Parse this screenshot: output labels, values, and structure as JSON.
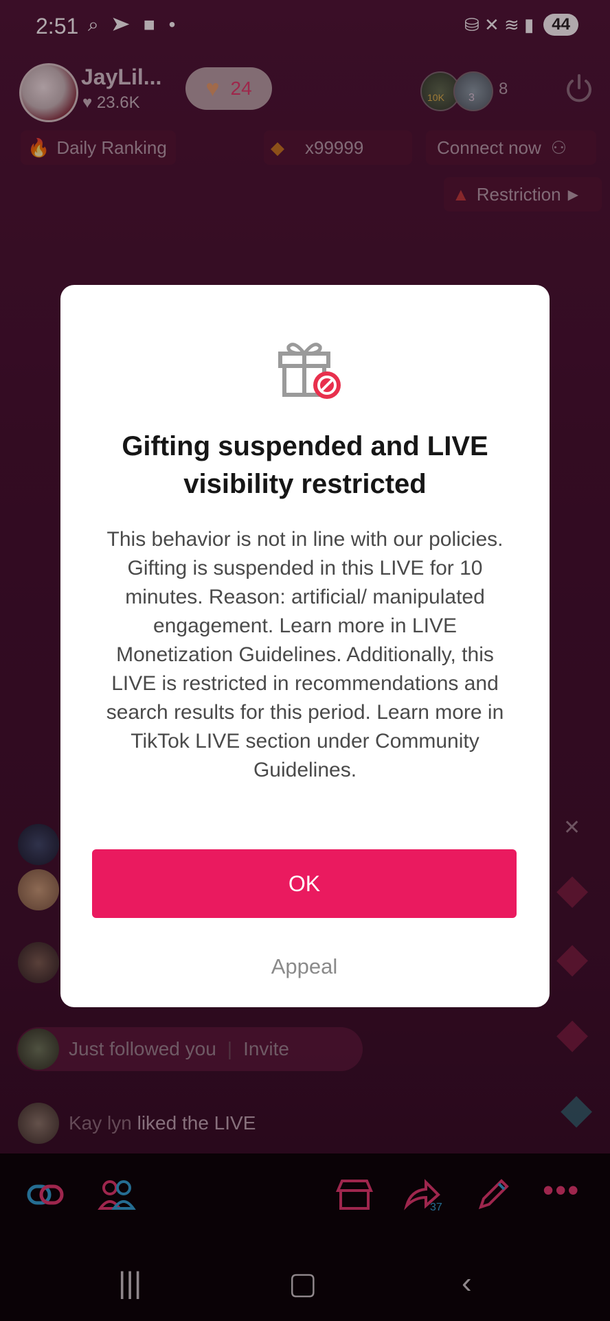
{
  "status_bar": {
    "time": "2:51",
    "left_icons": "⌕ ➤ ■ •",
    "right_icons": "⛁ ✕ ≋ ▮",
    "battery": "44"
  },
  "host": {
    "name": "JayLil...",
    "likes": "♥ 23.6K",
    "heart_count": "24"
  },
  "viewers": {
    "badge1": "10K",
    "badge2": "3",
    "count": "8"
  },
  "top_pills": {
    "daily_ranking": "Daily Ranking",
    "multiplier": "x99999",
    "connect_now": "Connect now",
    "restriction": "Restriction"
  },
  "modal": {
    "title": "Gifting suspended and LIVE visibility restricted",
    "body": "This behavior is not in line with our policies. Gifting is suspended in this LIVE for 10 minutes. Reason: artificial/ manipulated engagement. Learn more in LIVE Monetization Guidelines. Additionally, this LIVE is restricted in recommendations and search results for this period. Learn more in TikTok LIVE section under Community Guidelines.",
    "ok_label": "OK",
    "appeal_label": "Appeal"
  },
  "feed": {
    "followed_text": "Just followed you",
    "invite_label": "Invite",
    "liked_user": "Kay lyn",
    "liked_text": " liked the LIVE"
  },
  "toolbar": {
    "share_count": "37"
  },
  "colors": {
    "accent": "#ea1a5f",
    "background": "#3e0f2b"
  }
}
